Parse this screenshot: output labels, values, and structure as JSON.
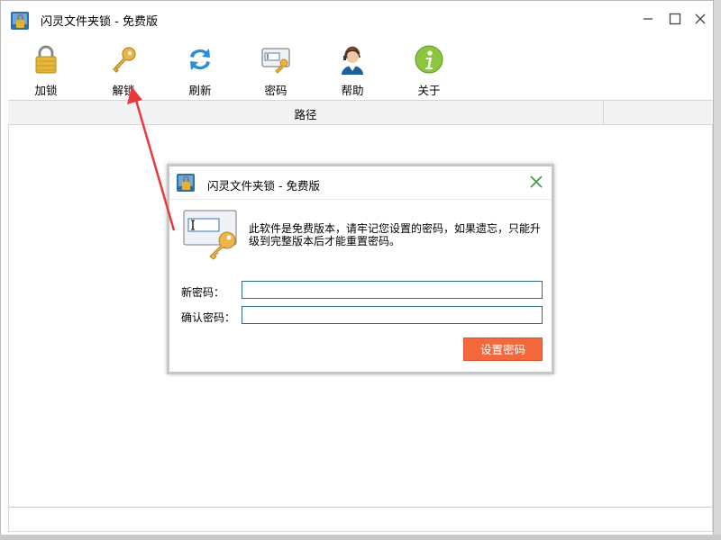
{
  "window": {
    "title": "闪灵文件夹锁 - 免费版",
    "controls": [
      "minimize-icon",
      "maximize-icon",
      "close-icon"
    ]
  },
  "toolbar": {
    "items": [
      {
        "label": "加锁",
        "icon": "padlock-icon"
      },
      {
        "label": "解锁",
        "icon": "key-icon"
      },
      {
        "label": "刷新",
        "icon": "refresh-icon"
      },
      {
        "label": "密码",
        "icon": "password-icon"
      },
      {
        "label": "帮助",
        "icon": "support-agent-icon"
      },
      {
        "label": "关于",
        "icon": "info-icon"
      }
    ]
  },
  "grid": {
    "columns": [
      "路径"
    ]
  },
  "dialog": {
    "title": "闪灵文件夹锁 - 免费版",
    "message": "此软件是免费版本，请牢记您设置的密码，如果遗忘，只能升级到完整版本后才能重置密码。",
    "new_password_label": "新密码：",
    "confirm_password_label": "确认密码：",
    "new_password_value": "",
    "confirm_password_value": "",
    "submit_label": "设置密码"
  },
  "colors": {
    "accent_button": "#f4693c",
    "annotation_arrow": "#e8393b",
    "input_border": "#2e6c8a",
    "close_x": "#3f9a3f"
  }
}
